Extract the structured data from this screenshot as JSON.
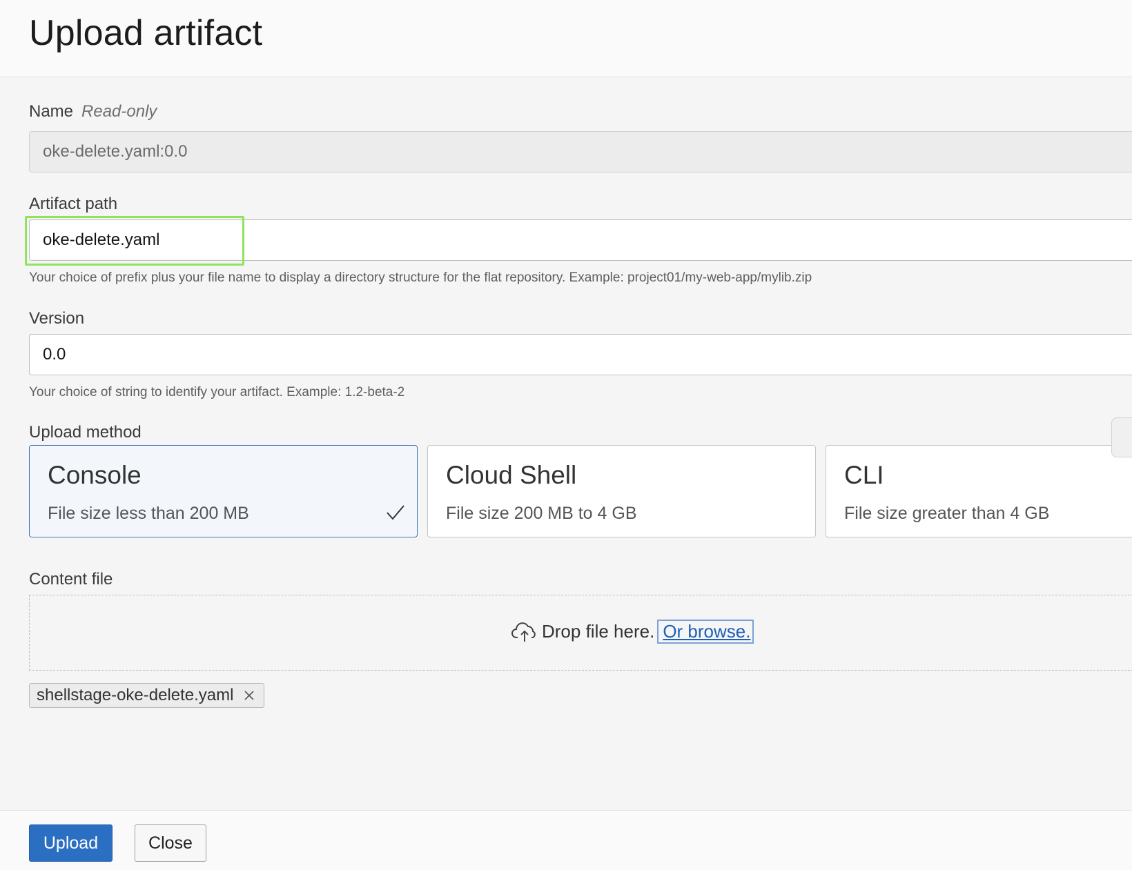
{
  "header": {
    "title": "Upload artifact"
  },
  "name_field": {
    "label": "Name",
    "readonly_tag": "Read-only",
    "value": "oke-delete.yaml:0.0"
  },
  "artifact_path": {
    "label": "Artifact path",
    "value": "oke-delete.yaml",
    "help": "Your choice of prefix plus your file name to display a directory structure for the flat repository. Example: project01/my-web-app/mylib.zip"
  },
  "version": {
    "label": "Version",
    "value": "0.0",
    "help": "Your choice of string to identify your artifact. Example: 1.2-beta-2"
  },
  "upload_method": {
    "label": "Upload method",
    "options": [
      {
        "title": "Console",
        "subtitle": "File size less than 200 MB",
        "selected": true
      },
      {
        "title": "Cloud Shell",
        "subtitle": "File size 200 MB to 4 GB",
        "selected": false
      },
      {
        "title": "CLI",
        "subtitle": "File size greater than 4 GB",
        "selected": false
      }
    ]
  },
  "content_file": {
    "label": "Content file",
    "drop_text": "Drop file here.",
    "browse_text": "Or browse.",
    "selected_file": "shellstage-oke-delete.yaml",
    "icons": {
      "upload": "cloud-upload-icon",
      "remove": "close-icon"
    }
  },
  "footer": {
    "upload_label": "Upload",
    "close_label": "Close"
  },
  "colors": {
    "primary": "#2b6fc2",
    "selected_border": "#3a73b8",
    "focus_ring": "#8ee45a",
    "link": "#1d5fb8"
  }
}
